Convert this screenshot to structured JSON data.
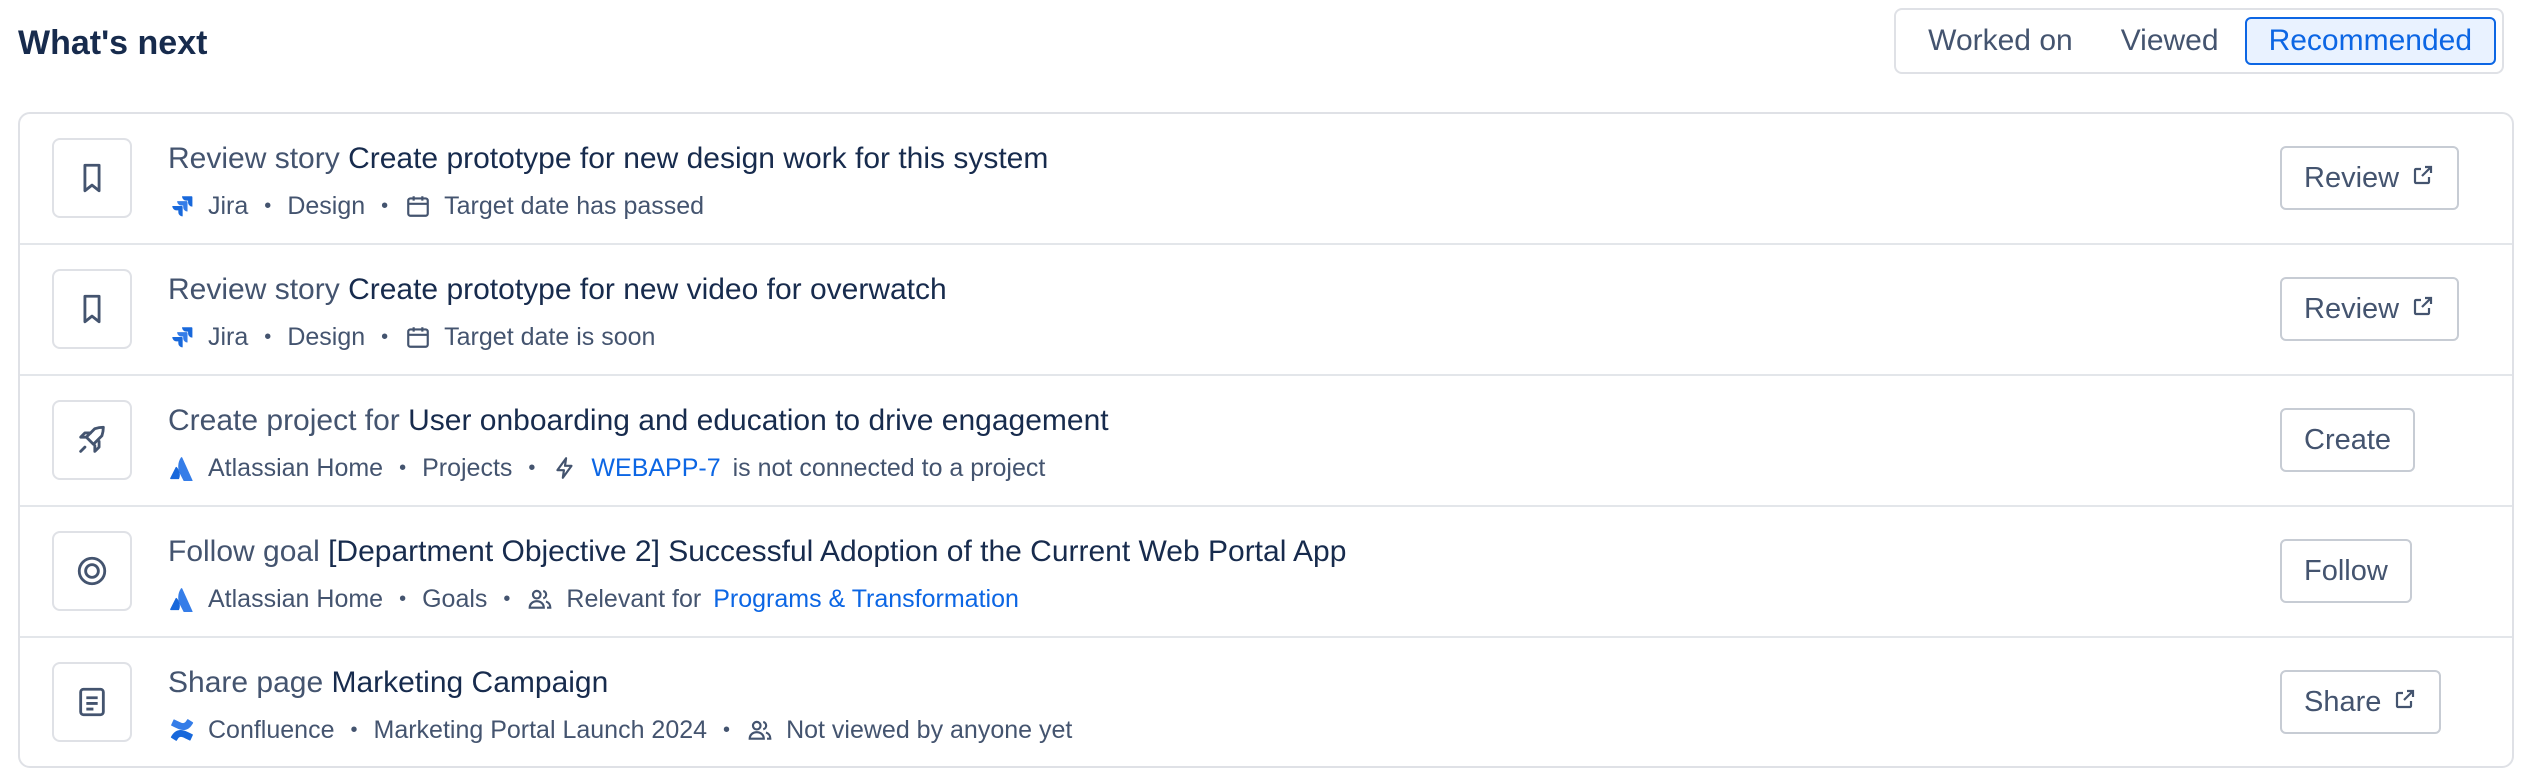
{
  "header": {
    "title": "What's next",
    "tabs": [
      "Worked on",
      "Viewed",
      "Recommended"
    ],
    "active_tab": "Recommended"
  },
  "colors": {
    "accent": "#0c66e4",
    "accent_bg": "#e9f2ff",
    "text": "#172b4d",
    "subtle_text": "#44546f",
    "border": "#dfe1e6"
  },
  "items": [
    {
      "icon": "bookmark-icon",
      "verb": "Review story",
      "object": "Create prototype for new design work for this system",
      "source_icon": "jira-icon",
      "source": "Jira",
      "category": "Design",
      "detail_icon": "calendar-icon",
      "detail_prefix": "",
      "detail_link": "",
      "detail_suffix": "Target date has passed",
      "action": "Review",
      "action_icon": "external-link-icon"
    },
    {
      "icon": "bookmark-icon",
      "verb": "Review story",
      "object": "Create prototype for new video for overwatch",
      "source_icon": "jira-icon",
      "source": "Jira",
      "category": "Design",
      "detail_icon": "calendar-icon",
      "detail_prefix": "",
      "detail_link": "",
      "detail_suffix": "Target date is soon",
      "action": "Review",
      "action_icon": "external-link-icon"
    },
    {
      "icon": "rocket-icon",
      "verb": "Create project for",
      "object": "User onboarding and education to drive engagement",
      "source_icon": "atlassian-icon",
      "source": "Atlassian Home",
      "category": "Projects",
      "detail_icon": "lightning-icon",
      "detail_prefix": "",
      "detail_link": "WEBAPP-7",
      "detail_suffix": "is not connected to a project",
      "action": "Create",
      "action_icon": ""
    },
    {
      "icon": "target-icon",
      "verb": "Follow goal",
      "object": "[Department Objective 2] Successful Adoption of the Current Web Portal App",
      "source_icon": "atlassian-icon",
      "source": "Atlassian Home",
      "category": "Goals",
      "detail_icon": "people-icon",
      "detail_prefix": "Relevant for",
      "detail_link": "Programs & Transformation",
      "detail_suffix": "",
      "action": "Follow",
      "action_icon": ""
    },
    {
      "icon": "page-icon",
      "verb": "Share page",
      "object": "Marketing Campaign",
      "source_icon": "confluence-icon",
      "source": "Confluence",
      "category": "Marketing Portal Launch 2024",
      "detail_icon": "people-icon",
      "detail_prefix": "",
      "detail_link": "",
      "detail_suffix": "Not viewed by anyone yet",
      "action": "Share",
      "action_icon": "external-link-icon"
    }
  ]
}
